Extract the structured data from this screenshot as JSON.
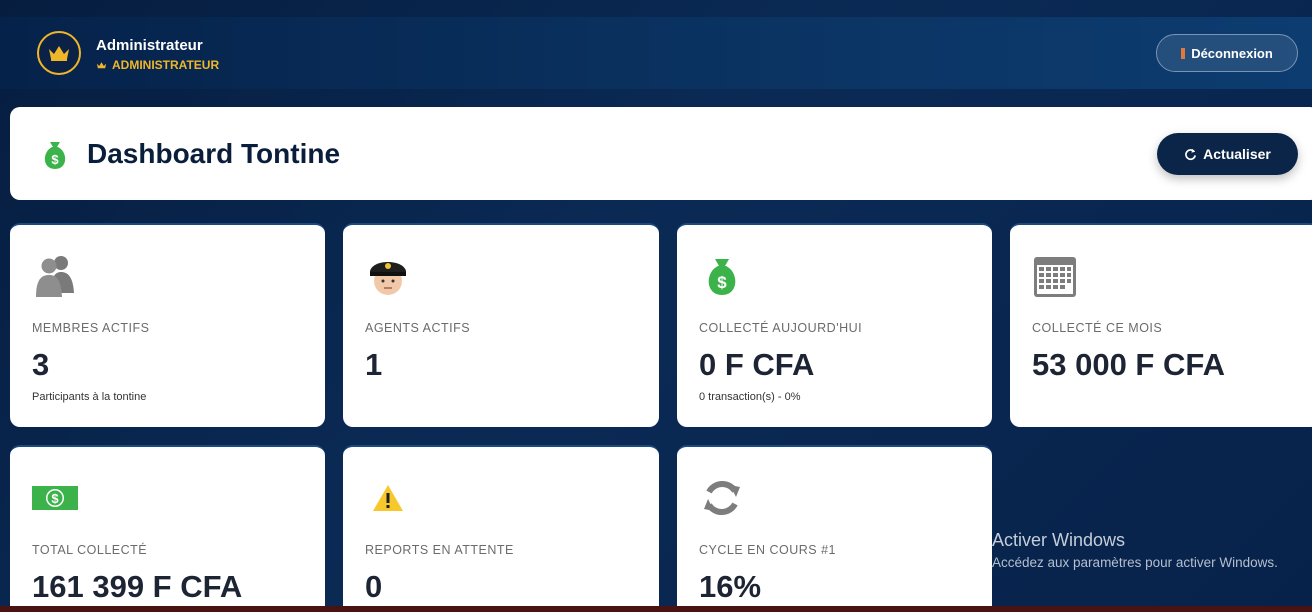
{
  "user": {
    "name": "Administrateur",
    "role": "ADMINISTRATEUR"
  },
  "topbar": {
    "logout_label": "Déconnexion"
  },
  "header": {
    "title": "Dashboard Tontine",
    "refresh_label": "Actualiser"
  },
  "cards": [
    {
      "label": "MEMBRES ACTIFS",
      "value": "3",
      "sub": "Participants à la tontine",
      "icon": "people-icon"
    },
    {
      "label": "AGENTS ACTIFS",
      "value": "1",
      "sub": "",
      "icon": "police-officer-icon"
    },
    {
      "label": "COLLECTÉ AUJOURD'HUI",
      "value": "0 F CFA",
      "sub": "0 transaction(s) - 0%",
      "icon": "money-bag-icon"
    },
    {
      "label": "COLLECTÉ CE MOIS",
      "value": "53 000 F CFA",
      "sub": "",
      "icon": "calendar-icon"
    },
    {
      "label": "TOTAL COLLECTÉ",
      "value": "161 399 F CFA",
      "sub": "",
      "icon": "dollar-banknote-icon"
    },
    {
      "label": "REPORTS EN ATTENTE",
      "value": "0",
      "sub": "",
      "icon": "warning-icon"
    },
    {
      "label": "CYCLE EN COURS #1",
      "value": "16%",
      "sub": "",
      "icon": "refresh-cycle-icon"
    }
  ],
  "watermark": {
    "title": "Activer Windows",
    "subtitle": "Accédez aux paramètres pour activer Windows."
  },
  "colors": {
    "navy": "#0a2a55",
    "gold": "#f0b62a",
    "green": "#3cb34a",
    "text": "#1d2433"
  }
}
